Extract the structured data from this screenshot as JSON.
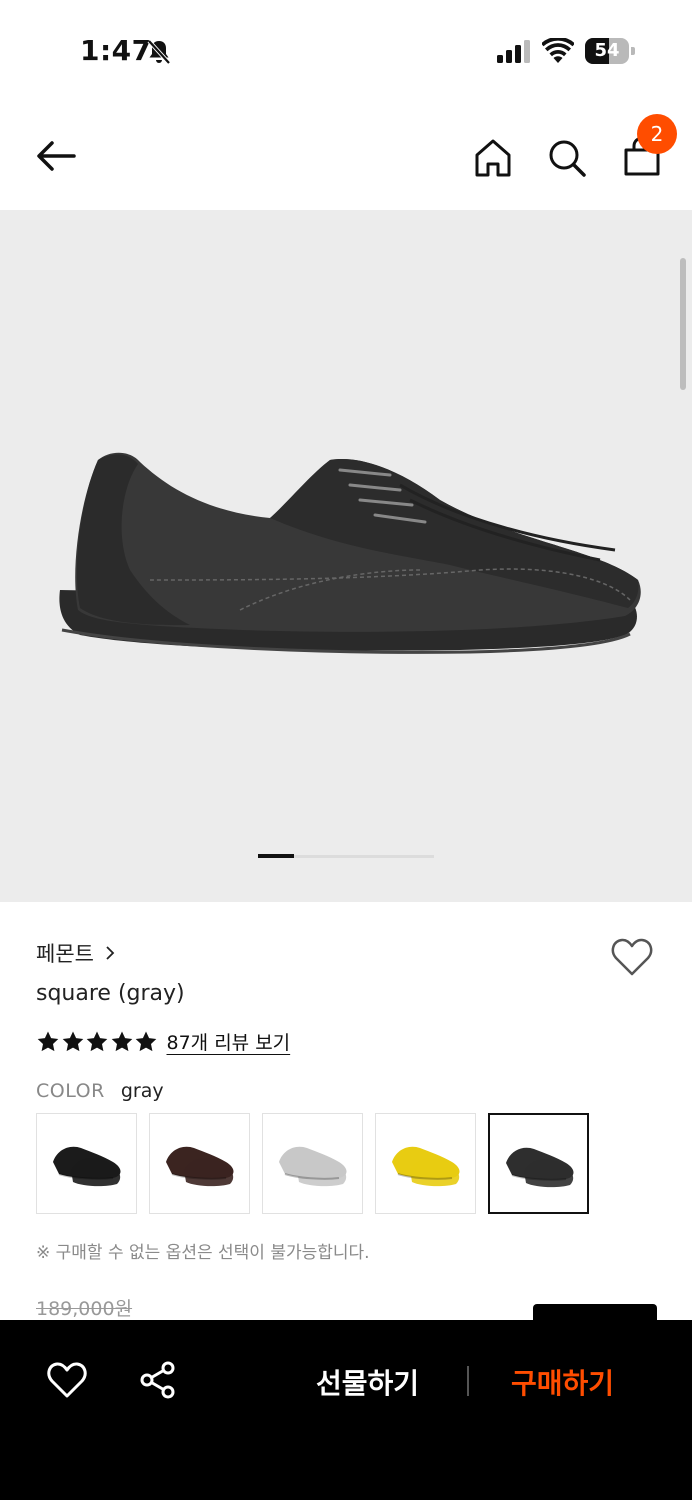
{
  "status": {
    "time": "1:47",
    "battery": "54",
    "battery_level": 0.54
  },
  "header": {
    "cart_count": "2"
  },
  "gallery": {
    "image_count": 5,
    "current_index": 1
  },
  "product": {
    "brand": "페몬트",
    "name": "square (gray)",
    "rating": 5,
    "review_link": "87개 리뷰 보기",
    "color_label": "COLOR",
    "color_value": "gray",
    "swatches": [
      {
        "color": "black",
        "hex": "#1b1b1b"
      },
      {
        "color": "brown",
        "hex": "#3b2420"
      },
      {
        "color": "silver",
        "hex": "#c8c8c8"
      },
      {
        "color": "yellow",
        "hex": "#e8cc12"
      },
      {
        "color": "gray",
        "hex": "#2e2e2e",
        "selected": true
      }
    ],
    "notice": "※ 구매할 수 없는 옵션은 선택이 불가능합니다.",
    "original_price": "189,000원"
  },
  "bottom_bar": {
    "gift_label": "선물하기",
    "buy_label": "구매하기"
  },
  "colors": {
    "accent": "#ff4d00",
    "bar": "#000000",
    "gallery_bg": "#ececec"
  }
}
